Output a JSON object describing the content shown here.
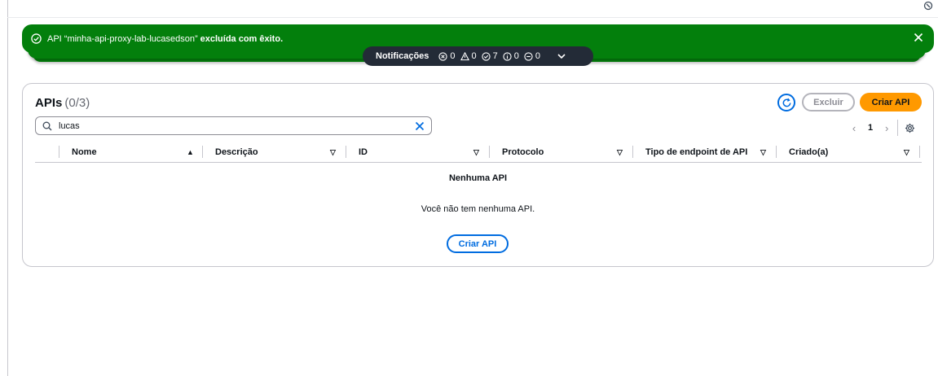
{
  "flash": {
    "message_prefix": "API “minha-api-proxy-lab-lucasedson”",
    "message_strong": "excluída com êxito."
  },
  "notifications": {
    "label": "Notificações",
    "error_count": "0",
    "warning_count": "0",
    "success_count": "7",
    "info_count": "0",
    "progress_count": "0"
  },
  "panel": {
    "title": "APIs",
    "count": "(0/3)",
    "delete_label": "Excluir",
    "create_label": "Criar API"
  },
  "search": {
    "value": "lucas"
  },
  "pagination": {
    "current_page": "1"
  },
  "table": {
    "columns": [
      {
        "label": "Nome",
        "sort": "▲"
      },
      {
        "label": "Descrição",
        "sort": "▽"
      },
      {
        "label": "ID",
        "sort": "▽"
      },
      {
        "label": "Protocolo",
        "sort": "▽"
      },
      {
        "label": "Tipo de endpoint de API",
        "sort": "▽"
      },
      {
        "label": "Criado(a)",
        "sort": "▽"
      }
    ],
    "empty_title": "Nenhuma API",
    "empty_message": "Você não tem nenhuma API.",
    "empty_button": "Criar API"
  },
  "colors": {
    "success": "#037f0c",
    "notification_bar": "#232b37",
    "primary": "#ff9900",
    "link": "#006ce0"
  }
}
